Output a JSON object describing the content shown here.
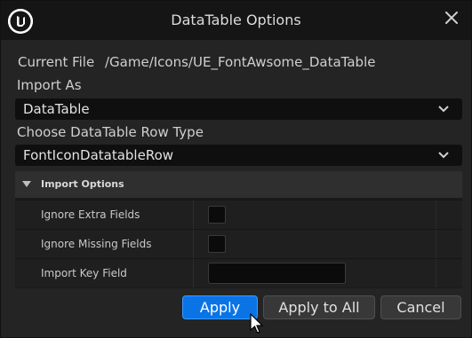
{
  "window": {
    "title": "DataTable Options"
  },
  "current_file": {
    "label": "Current File",
    "value": "/Game/Icons/UE_FontAwsome_DataTable"
  },
  "import_as": {
    "label": "Import As",
    "value": "DataTable"
  },
  "row_type": {
    "label": "Choose DataTable Row Type",
    "value": "FontIconDatatableRow"
  },
  "import_options": {
    "header": "Import Options",
    "rows": [
      {
        "label": "Ignore Extra Fields",
        "checked": false
      },
      {
        "label": "Ignore Missing Fields",
        "checked": false
      },
      {
        "label": "Import Key Field",
        "value": ""
      }
    ]
  },
  "buttons": {
    "apply": "Apply",
    "apply_all": "Apply to All",
    "cancel": "Cancel"
  },
  "colors": {
    "accent": "#0a74e6",
    "background": "#242424",
    "titlebar": "#151515"
  }
}
